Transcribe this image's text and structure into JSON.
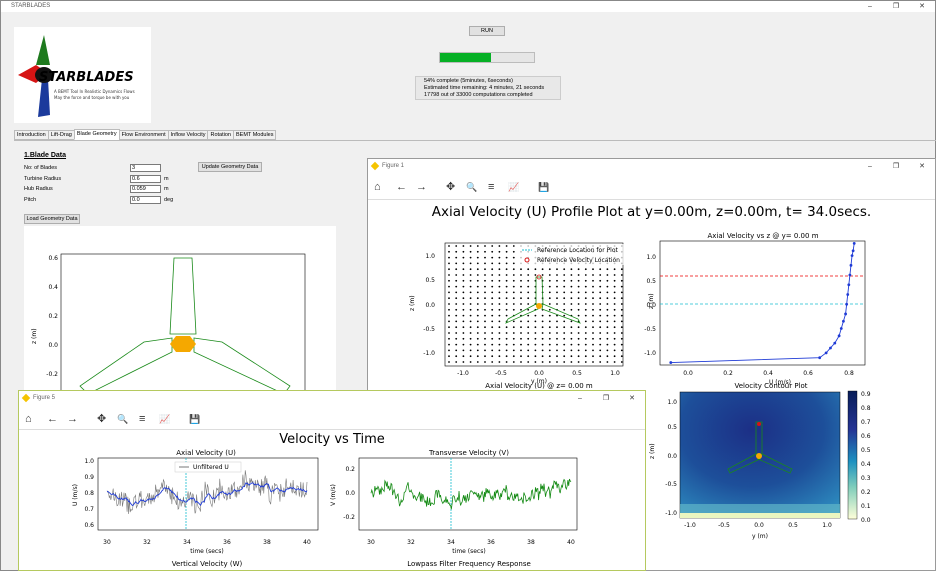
{
  "app": {
    "title": "STARBLADES",
    "logo_text": "STARBLADES",
    "tagline1": "A BEMT Tool In Realistic Dynamics Flows",
    "tagline2": "May the force and torque be with you",
    "win_min": "–",
    "win_max": "❐",
    "win_close": "✕"
  },
  "run": {
    "label": "RUN",
    "progress": 0.54,
    "status": [
      "54% complete (5minutes, 6seconds)",
      "Estimated time remaining: 4 minutes, 21 seconds",
      "17798 out of 33000 computations completed"
    ]
  },
  "tabs": [
    "Introduction",
    "Lift-Drag",
    "Blade Geometry",
    "Flow Environment",
    "Inflow Velocity",
    "Rotation",
    "BEMT Modules"
  ],
  "blade": {
    "heading": "1.Blade Data",
    "fields": [
      {
        "label": "No: of Blades",
        "value": "3",
        "unit": ""
      },
      {
        "label": "Turbine Radius",
        "value": "0.6",
        "unit": "m"
      },
      {
        "label": "Hub Radius",
        "value": "0.059",
        "unit": "m"
      },
      {
        "label": "Pitch",
        "value": "0.0",
        "unit": "deg"
      }
    ],
    "update_label": "Update Geometry Data",
    "load_label": "Load Geometry Data",
    "plot_ylabel": "z (m)",
    "plot_yticks": [
      "0.6",
      "0.4",
      "0.2",
      "0.0",
      "-0.2"
    ]
  },
  "fig1": {
    "title": "Figure 1",
    "suptitle": "Axial Velocity (U) Profile Plot at y=0.00m, z=0.00m, t= 34.0secs.",
    "left": {
      "ylabel": "z (m)",
      "xlabel": "y (m)",
      "yticks": [
        "1.0",
        "0.5",
        "0.0",
        "-0.5",
        "-1.0"
      ],
      "xticks": [
        "-1.0",
        "-0.5",
        "0.0",
        "0.5",
        "1.0"
      ],
      "legend1": "Reference Location for Plot",
      "legend2": "Reference Velocity Location",
      "bottom_title": "Axial Velocity (U) @ z= 0.00 m"
    },
    "right": {
      "title": "Axial Velocity vs z @ y= 0.00 m",
      "ylabel": "z (m)",
      "xlabel": "U (m/s)",
      "yticks": [
        "1.0",
        "0.5",
        "0.0",
        "-0.5",
        "-1.0"
      ],
      "xticks": [
        "0.0",
        "0.2",
        "0.4",
        "0.6",
        "0.8"
      ],
      "contour_title": "Velocity Contour Plot",
      "contour_ylabel": "z (m)",
      "contour_xlabel": "y (m)",
      "contour_yticks": [
        "1.0",
        "0.5",
        "0.0",
        "-0.5",
        "-1.0"
      ],
      "contour_xticks": [
        "-1.0",
        "-0.5",
        "0.0",
        "0.5",
        "1.0"
      ],
      "cbar_ticks": [
        "0.9",
        "0.8",
        "0.7",
        "0.6",
        "0.5",
        "0.4",
        "0.3",
        "0.2",
        "0.1",
        "0.0"
      ]
    }
  },
  "fig5": {
    "title": "Figure 5",
    "suptitle": "Velocity vs Time",
    "ax1": {
      "title": "Axial Velocity (U)",
      "ylabel": "U (m/s)",
      "xlabel": "time (secs)",
      "legend": "Unfiltered U",
      "yticks": [
        "1.0",
        "0.9",
        "0.8",
        "0.7",
        "0.6"
      ],
      "xticks": [
        "30",
        "32",
        "34",
        "36",
        "38",
        "40"
      ]
    },
    "ax2": {
      "title": "Transverse Velocity (V)",
      "ylabel": "V (m/s)",
      "xlabel": "time (secs)",
      "yticks": [
        "0.2",
        "0.0",
        "-0.2"
      ],
      "xticks": [
        "30",
        "32",
        "34",
        "36",
        "38",
        "40"
      ]
    },
    "bottom_left_title": "Vertical Velocity (W)",
    "bottom_right_title": "Lowpass Filter Frequency Response"
  },
  "toolbar": {
    "home": "⌂",
    "back": "←",
    "forward": "→",
    "pan": "✥",
    "zoom": "🔍",
    "config": "≡",
    "edit": "📈",
    "save": "💾"
  },
  "chart_data": [
    {
      "type": "line",
      "title": "Axial Velocity vs z @ y= 0.00 m",
      "xlabel": "U (m/s)",
      "ylabel": "z (m)",
      "series": [
        {
          "x": [
            0.0,
            0.69,
            0.72,
            0.74,
            0.76,
            0.78,
            0.79,
            0.8,
            0.81,
            0.815,
            0.82,
            0.825,
            0.83,
            0.835,
            0.84,
            0.845,
            0.85
          ],
          "y": [
            -1.2,
            -1.1,
            -1.0,
            -0.9,
            -0.8,
            -0.65,
            -0.5,
            -0.35,
            -0.2,
            0.0,
            0.2,
            0.4,
            0.6,
            0.8,
            1.0,
            1.1,
            1.25
          ]
        }
      ],
      "xlim": [
        -0.05,
        0.9
      ],
      "ylim": [
        -1.25,
        1.3
      ]
    },
    {
      "type": "line",
      "title": "Axial Velocity (U)",
      "xlabel": "time (secs)",
      "ylabel": "U (m/s)",
      "xlim": [
        30,
        40
      ],
      "ylim": [
        0.55,
        1.0
      ]
    },
    {
      "type": "line",
      "title": "Transverse Velocity (V)",
      "xlabel": "time (secs)",
      "ylabel": "V (m/s)",
      "xlim": [
        30,
        40
      ],
      "ylim": [
        -0.3,
        0.3
      ]
    }
  ]
}
